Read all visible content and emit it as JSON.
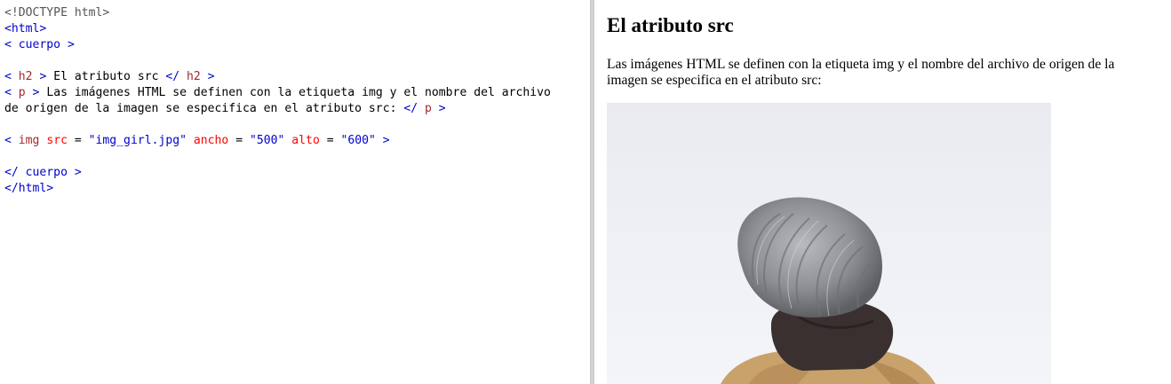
{
  "editor": {
    "doctype": "<!DOCTYPE html>",
    "html_open": "<html>",
    "body_open": "< cuerpo >",
    "h2": {
      "open_lt": "< ",
      "open_name": "h2",
      "open_gt": " >",
      "text": " El atributo src ",
      "close_lt": "</ ",
      "close_name": "h2",
      "close_gt": " >"
    },
    "p": {
      "open_lt": "< ",
      "open_name": "p",
      "open_gt": " >",
      "text_line1": " Las imágenes HTML se definen con la etiqueta img y el nombre del archivo",
      "text_line2": "de origen de la imagen se especifica en el atributo src: ",
      "close_lt": "</ ",
      "close_name": "p",
      "close_gt": " >"
    },
    "img": {
      "lt": "< ",
      "name": "img",
      "src_attr": " src",
      "eq1": " = ",
      "src_val": "\"img_girl.jpg\"",
      "width_attr": " ancho",
      "eq2": " = ",
      "width_val": "\"500\"",
      "height_attr": " alto",
      "eq3": " = ",
      "height_val": "\"600\"",
      "gt": " >"
    },
    "body_close": "</ cuerpo >",
    "html_close": "</html>"
  },
  "preview": {
    "heading": "El atributo src",
    "paragraph": "Las imágenes HTML se definen con la etiqueta img y el nombre del archivo de origen de la imagen se especifica en el atributo src:",
    "image": {
      "description": "person wearing a grey knitted beanie seen from behind",
      "colors": {
        "sky": "#eef0f4",
        "beanie": "#8d8f93",
        "collar": "#3a3030",
        "coat": "#c9a26b"
      }
    }
  }
}
